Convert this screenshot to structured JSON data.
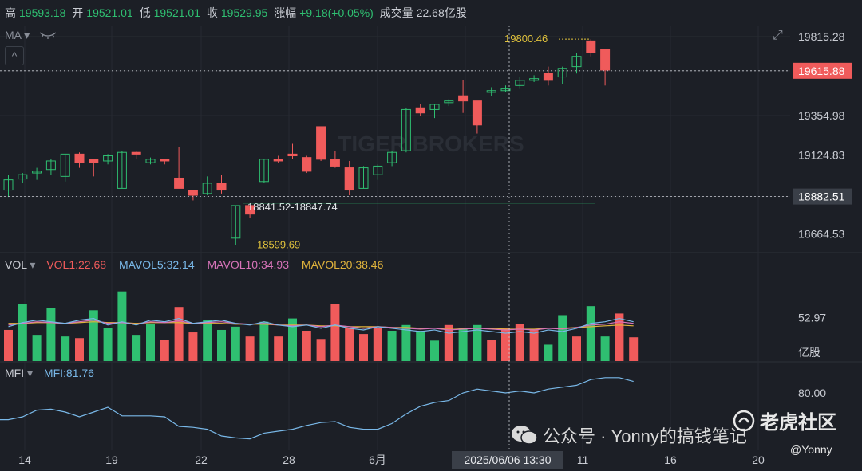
{
  "quote": {
    "high_label": "高",
    "high": "19593.18",
    "open_label": "开",
    "open": "19521.01",
    "low_label": "低",
    "low": "19521.01",
    "close_label": "收",
    "close": "19529.95",
    "change_label": "涨幅",
    "change": "+9.18(+0.05%)",
    "volume_label": "成交量",
    "volume": "22.68亿股"
  },
  "toolbar": {
    "ma_label": "MA",
    "dropdown_icon": "▾",
    "eye_icon": "hidden-eye-icon",
    "collapse_icon": "^",
    "expand_icon": "⤢"
  },
  "price_axis": {
    "ticks": [
      "19815.28",
      "19615.88",
      "19354.98",
      "19124.83",
      "18882.51",
      "18664.53"
    ]
  },
  "annotations": {
    "high_marker": "19800.46",
    "low_marker": "18599.69",
    "range_text": "18841.52-18847.74"
  },
  "vol_panel": {
    "title": "VOL",
    "dropdown_icon": "▾",
    "vol1": "VOL1:22.68",
    "mavol5": "MAVOL5:32.14",
    "mavol10": "MAVOL10:34.93",
    "mavol20": "MAVOL20:38.46",
    "axis_tick": "52.97",
    "axis_unit": "亿股"
  },
  "mfi_panel": {
    "title": "MFI",
    "dropdown_icon": "▾",
    "mfi": "MFI:81.76",
    "axis_tick": "80.00"
  },
  "x_axis": {
    "ticks": [
      "14",
      "19",
      "22",
      "28",
      "6月",
      "11",
      "16",
      "20"
    ],
    "crosshair_label": "2025/06/06 13:30"
  },
  "watermark": {
    "brand": "老虎社区",
    "handle": "@Yonny",
    "wechat": "公众号 · Yonny的搞钱笔记",
    "bg_brand": "TIGER BROKERS"
  },
  "colors": {
    "up": "#2fbf71",
    "down": "#f05b5b",
    "bg": "#1c1f26",
    "ma5": "#79b8e8",
    "ma10": "#d673b8",
    "ma20": "#e0b33c",
    "mfi": "#79b8e8"
  },
  "chart_data": {
    "type": "candlestick",
    "price_ylim": [
      18560,
      19880
    ],
    "candles": [
      {
        "o": 18920,
        "h": 19010,
        "l": 18880,
        "c": 18980
      },
      {
        "o": 18985,
        "h": 19020,
        "l": 18960,
        "c": 19010
      },
      {
        "o": 19020,
        "h": 19050,
        "l": 18980,
        "c": 19030
      },
      {
        "o": 19040,
        "h": 19100,
        "l": 19010,
        "c": 19090
      },
      {
        "o": 19000,
        "h": 19130,
        "l": 18970,
        "c": 19130
      },
      {
        "o": 19130,
        "h": 19140,
        "l": 19050,
        "c": 19080
      },
      {
        "o": 19100,
        "h": 19100,
        "l": 19000,
        "c": 19080
      },
      {
        "o": 19090,
        "h": 19130,
        "l": 19070,
        "c": 19120
      },
      {
        "o": 18930,
        "h": 19150,
        "l": 18930,
        "c": 19140
      },
      {
        "o": 19140,
        "h": 19150,
        "l": 19100,
        "c": 19130
      },
      {
        "o": 19080,
        "h": 19110,
        "l": 19070,
        "c": 19100
      },
      {
        "o": 19100,
        "h": 19100,
        "l": 19070,
        "c": 19090
      },
      {
        "o": 18990,
        "h": 19170,
        "l": 18930,
        "c": 18930
      },
      {
        "o": 18920,
        "h": 18920,
        "l": 18860,
        "c": 18890
      },
      {
        "o": 18900,
        "h": 19000,
        "l": 18890,
        "c": 18960
      },
      {
        "o": 18960,
        "h": 19010,
        "l": 18900,
        "c": 18920
      },
      {
        "o": 18640,
        "h": 18830,
        "l": 18599.69,
        "c": 18830
      },
      {
        "o": 18830,
        "h": 18830,
        "l": 18760,
        "c": 18780
      },
      {
        "o": 18970,
        "h": 19100,
        "l": 18960,
        "c": 19100
      },
      {
        "o": 19100,
        "h": 19120,
        "l": 19080,
        "c": 19090
      },
      {
        "o": 19130,
        "h": 19190,
        "l": 19100,
        "c": 19120
      },
      {
        "o": 19110,
        "h": 19120,
        "l": 19020,
        "c": 19030
      },
      {
        "o": 19290,
        "h": 19290,
        "l": 19090,
        "c": 19100
      },
      {
        "o": 19100,
        "h": 19150,
        "l": 19050,
        "c": 19060
      },
      {
        "o": 19050,
        "h": 19090,
        "l": 18890,
        "c": 18920
      },
      {
        "o": 18930,
        "h": 19060,
        "l": 18930,
        "c": 19050
      },
      {
        "o": 19010,
        "h": 19070,
        "l": 18980,
        "c": 19060
      },
      {
        "o": 19080,
        "h": 19150,
        "l": 19060,
        "c": 19140
      },
      {
        "o": 19150,
        "h": 19400,
        "l": 19140,
        "c": 19390
      },
      {
        "o": 19400,
        "h": 19420,
        "l": 19350,
        "c": 19370
      },
      {
        "o": 19390,
        "h": 19420,
        "l": 19340,
        "c": 19420
      },
      {
        "o": 19430,
        "h": 19450,
        "l": 19410,
        "c": 19440
      },
      {
        "o": 19470,
        "h": 19560,
        "l": 19370,
        "c": 19440
      },
      {
        "o": 19440,
        "h": 19440,
        "l": 19250,
        "c": 19300
      },
      {
        "o": 19490,
        "h": 19520,
        "l": 19470,
        "c": 19500
      },
      {
        "o": 19500,
        "h": 19530,
        "l": 19490,
        "c": 19510
      },
      {
        "o": 19530,
        "h": 19580,
        "l": 19510,
        "c": 19560
      },
      {
        "o": 19560,
        "h": 19590,
        "l": 19550,
        "c": 19570
      },
      {
        "o": 19600,
        "h": 19640,
        "l": 19530,
        "c": 19560
      },
      {
        "o": 19580,
        "h": 19640,
        "l": 19540,
        "c": 19630
      },
      {
        "o": 19640,
        "h": 19720,
        "l": 19600,
        "c": 19700
      },
      {
        "o": 19790,
        "h": 19800.46,
        "l": 19700,
        "c": 19720
      },
      {
        "o": 19740,
        "h": 19740,
        "l": 19530,
        "c": 19620
      }
    ],
    "volume_ylim": [
      0,
      110
    ],
    "volumes": [
      {
        "v": 38,
        "up": false
      },
      {
        "v": 70,
        "up": true
      },
      {
        "v": 32,
        "up": true
      },
      {
        "v": 65,
        "up": true
      },
      {
        "v": 30,
        "up": true
      },
      {
        "v": 28,
        "up": false
      },
      {
        "v": 62,
        "up": true
      },
      {
        "v": 40,
        "up": true
      },
      {
        "v": 85,
        "up": true
      },
      {
        "v": 32,
        "up": true
      },
      {
        "v": 45,
        "up": true
      },
      {
        "v": 26,
        "up": false
      },
      {
        "v": 66,
        "up": false
      },
      {
        "v": 35,
        "up": false
      },
      {
        "v": 50,
        "up": true
      },
      {
        "v": 38,
        "up": true
      },
      {
        "v": 42,
        "up": true
      },
      {
        "v": 30,
        "up": false
      },
      {
        "v": 48,
        "up": true
      },
      {
        "v": 30,
        "up": false
      },
      {
        "v": 52,
        "up": true
      },
      {
        "v": 37,
        "up": false
      },
      {
        "v": 27,
        "up": false
      },
      {
        "v": 70,
        "up": false
      },
      {
        "v": 40,
        "up": false
      },
      {
        "v": 33,
        "up": false
      },
      {
        "v": 40,
        "up": false
      },
      {
        "v": 37,
        "up": true
      },
      {
        "v": 44,
        "up": true
      },
      {
        "v": 37,
        "up": true
      },
      {
        "v": 25,
        "up": true
      },
      {
        "v": 44,
        "up": false
      },
      {
        "v": 40,
        "up": true
      },
      {
        "v": 44,
        "up": true
      },
      {
        "v": 26,
        "up": false
      },
      {
        "v": 40,
        "up": false
      },
      {
        "v": 45,
        "up": false
      },
      {
        "v": 38,
        "up": false
      },
      {
        "v": 20,
        "up": true
      },
      {
        "v": 56,
        "up": true
      },
      {
        "v": 30,
        "up": false
      },
      {
        "v": 67,
        "up": true
      },
      {
        "v": 30,
        "up": true
      },
      {
        "v": 58,
        "up": false
      },
      {
        "v": 29,
        "up": false
      }
    ],
    "mavol5": [
      42,
      47,
      50,
      48,
      46,
      50,
      52,
      44,
      48,
      44,
      50,
      48,
      52,
      46,
      48,
      50,
      46,
      44,
      48,
      44,
      42,
      44,
      40,
      44,
      40,
      38,
      42,
      40,
      38,
      36,
      38,
      34,
      36,
      38,
      36,
      34,
      36,
      34,
      38,
      36,
      40,
      46,
      48,
      52,
      48
    ],
    "mavol10": [
      44,
      46,
      48,
      47,
      46,
      48,
      50,
      46,
      47,
      45,
      48,
      47,
      49,
      46,
      47,
      48,
      46,
      45,
      46,
      44,
      43,
      44,
      42,
      44,
      42,
      40,
      42,
      41,
      40,
      39,
      40,
      38,
      39,
      40,
      39,
      38,
      39,
      38,
      40,
      39,
      41,
      44,
      45,
      48,
      46
    ],
    "mavol20": [
      46,
      46,
      47,
      47,
      46,
      47,
      48,
      47,
      47,
      46,
      47,
      47,
      47,
      46,
      46,
      46,
      45,
      45,
      45,
      44,
      44,
      44,
      43,
      43,
      42,
      42,
      42,
      41,
      41,
      40,
      40,
      40,
      40,
      40,
      40,
      39,
      39,
      39,
      40,
      40,
      41,
      42,
      43,
      44,
      43
    ],
    "mfi_ylim": [
      20,
      100
    ],
    "mfi": [
      52,
      55,
      62,
      63,
      60,
      55,
      60,
      65,
      56,
      56,
      56,
      55,
      45,
      44,
      42,
      35,
      33,
      32,
      38,
      40,
      42,
      46,
      49,
      50,
      44,
      42,
      42,
      48,
      58,
      66,
      70,
      72,
      80,
      84,
      82,
      80,
      82,
      80,
      84,
      86,
      88,
      94,
      96,
      96,
      92
    ]
  }
}
